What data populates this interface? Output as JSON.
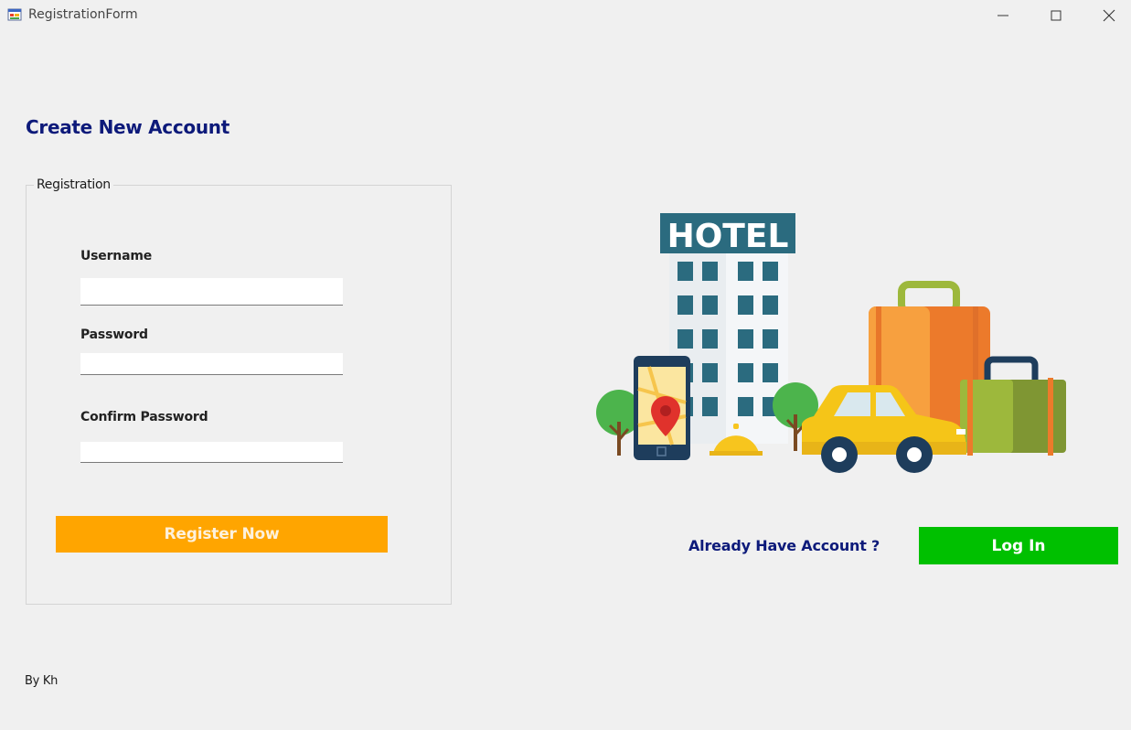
{
  "window": {
    "title": "RegistrationForm",
    "icons": {
      "app": "form-app-icon",
      "minimize": "minimize-icon",
      "maximize": "maximize-icon",
      "close": "close-icon"
    }
  },
  "page": {
    "title": "Create New Account"
  },
  "registration": {
    "group_label": "Registration",
    "username": {
      "label": "Username",
      "value": ""
    },
    "password": {
      "label": "Password",
      "value": ""
    },
    "confirm_password": {
      "label": "Confirm Password",
      "value": ""
    },
    "register_button": "Register Now"
  },
  "illustration": {
    "name": "hotel-travel-illustration",
    "sign_text": "HOTEL"
  },
  "login": {
    "prompt": "Already Have Account ?",
    "button": "Log In"
  },
  "footer": {
    "text": "By Kh"
  },
  "colors": {
    "title_blue": "#0d1a7a",
    "register_orange": "#ffa500",
    "login_green": "#00c000",
    "background": "#f0f0f0"
  }
}
